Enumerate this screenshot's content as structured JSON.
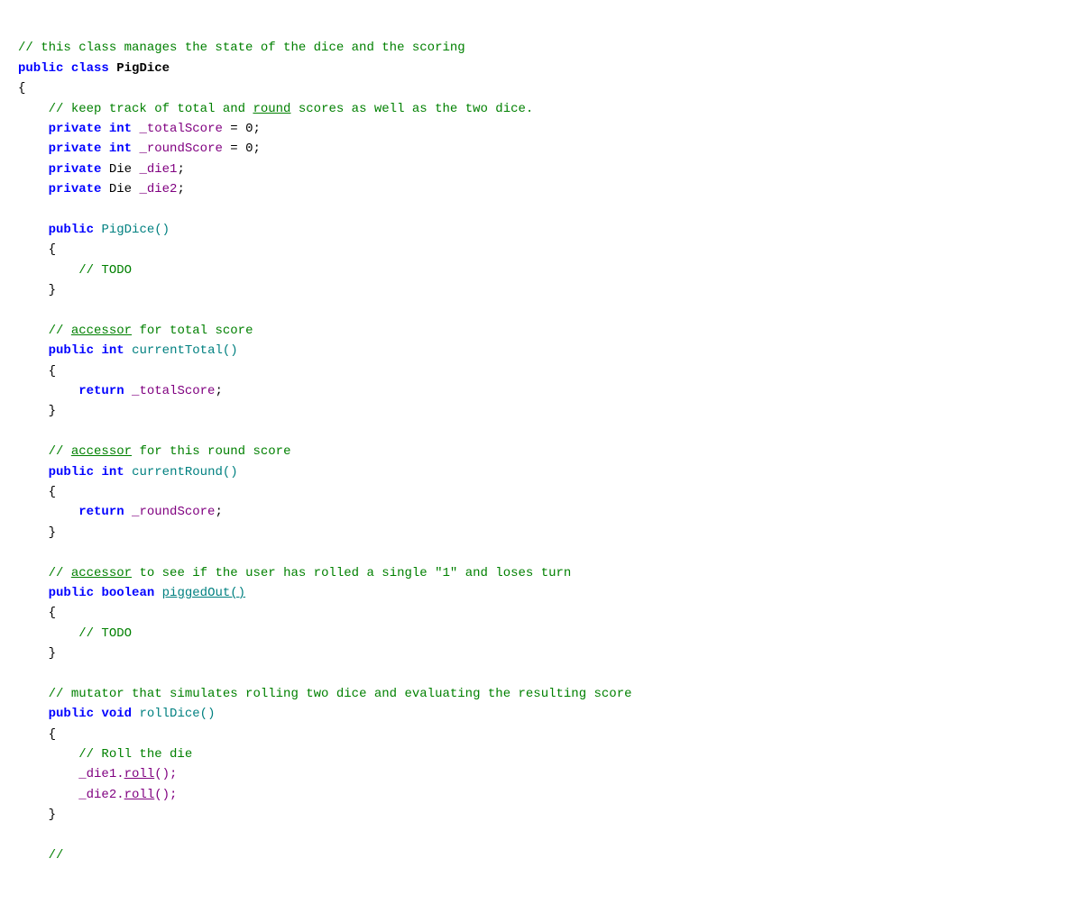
{
  "code": {
    "lines": [
      {
        "id": 1,
        "content": "comment_manages"
      },
      {
        "id": 2,
        "content": "class_decl"
      },
      {
        "id": 3,
        "content": "open_brace_0"
      },
      {
        "id": 4,
        "content": "comment_keep"
      },
      {
        "id": 5,
        "content": "field_total"
      },
      {
        "id": 6,
        "content": "field_round"
      },
      {
        "id": 7,
        "content": "field_die1"
      },
      {
        "id": 8,
        "content": "field_die2"
      },
      {
        "id": 9,
        "content": "blank"
      },
      {
        "id": 10,
        "content": "ctor_decl"
      },
      {
        "id": 11,
        "content": "open_brace_1"
      },
      {
        "id": 12,
        "content": "todo_1"
      },
      {
        "id": 13,
        "content": "close_brace_1"
      },
      {
        "id": 14,
        "content": "blank"
      },
      {
        "id": 15,
        "content": "comment_accessor_total"
      },
      {
        "id": 16,
        "content": "method_currentTotal"
      },
      {
        "id": 17,
        "content": "open_brace_2"
      },
      {
        "id": 18,
        "content": "return_total"
      },
      {
        "id": 19,
        "content": "close_brace_2"
      },
      {
        "id": 20,
        "content": "blank"
      },
      {
        "id": 21,
        "content": "comment_accessor_round"
      },
      {
        "id": 22,
        "content": "method_currentRound"
      },
      {
        "id": 23,
        "content": "open_brace_3"
      },
      {
        "id": 24,
        "content": "return_round"
      },
      {
        "id": 25,
        "content": "close_brace_3"
      },
      {
        "id": 26,
        "content": "blank"
      },
      {
        "id": 27,
        "content": "comment_accessor_pigged"
      },
      {
        "id": 28,
        "content": "method_piggedOut"
      },
      {
        "id": 29,
        "content": "open_brace_4"
      },
      {
        "id": 30,
        "content": "todo_2"
      },
      {
        "id": 31,
        "content": "close_brace_4"
      },
      {
        "id": 32,
        "content": "blank"
      },
      {
        "id": 33,
        "content": "comment_mutator"
      },
      {
        "id": 34,
        "content": "method_rollDice"
      },
      {
        "id": 35,
        "content": "open_brace_5"
      },
      {
        "id": 36,
        "content": "comment_roll"
      },
      {
        "id": 37,
        "content": "die1_roll"
      },
      {
        "id": 38,
        "content": "die2_roll"
      },
      {
        "id": 39,
        "content": "close_brace_5"
      },
      {
        "id": 40,
        "content": "blank"
      },
      {
        "id": 41,
        "content": "comment_continues"
      }
    ]
  }
}
